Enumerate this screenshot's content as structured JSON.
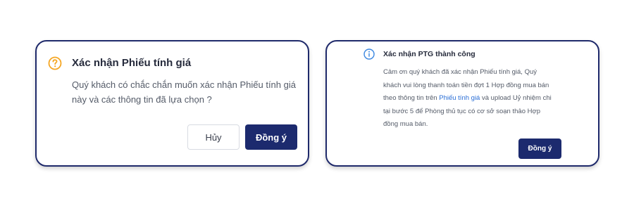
{
  "confirm_dialog": {
    "icon": "question-circle-icon",
    "title": "Xác nhận Phiếu tính giá",
    "message": "Quý khách có chắc chắn muốn xác nhận Phiếu tính giá này và các thông tin đã lựa chọn ?",
    "cancel_label": "Hủy",
    "confirm_label": "Đồng ý"
  },
  "success_dialog": {
    "icon": "info-circle-icon",
    "title": "Xác nhận PTG thành công",
    "message_part1": "Cảm ơn quý khách đã xác nhận Phiếu tính giá, Quý khách vui lòng thanh toán tiền đợt 1 Hợp đồng mua bán theo thông tin trên ",
    "message_link": "Phiếu tính giá",
    "message_part2": " và upload Uỷ nhiệm chi tại bước 5 để Phòng thủ tục có cơ sở soạn thảo Hợp đồng mua bán.",
    "confirm_label": "Đồng ý"
  },
  "colors": {
    "dialog_border": "#1f2a6b",
    "primary_button": "#1c2a6e",
    "warning_icon": "#f5a623",
    "info_icon": "#3a86e0",
    "link": "#2b6fd6"
  }
}
